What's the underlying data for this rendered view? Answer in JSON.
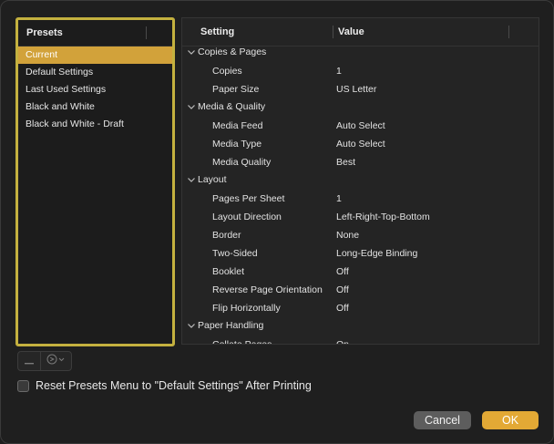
{
  "presets": {
    "header": "Presets",
    "items": [
      {
        "label": "Current",
        "selected": true
      },
      {
        "label": "Default Settings",
        "selected": false
      },
      {
        "label": "Last Used Settings",
        "selected": false
      },
      {
        "label": "Black and White",
        "selected": false
      },
      {
        "label": "Black and White - Draft",
        "selected": false
      }
    ]
  },
  "settings": {
    "header_setting": "Setting",
    "header_value": "Value",
    "rows": [
      {
        "type": "group",
        "label": "Copies & Pages",
        "value": ""
      },
      {
        "type": "item",
        "label": "Copies",
        "value": "1"
      },
      {
        "type": "item",
        "label": "Paper Size",
        "value": "US Letter"
      },
      {
        "type": "group",
        "label": "Media & Quality",
        "value": ""
      },
      {
        "type": "item",
        "label": "Media Feed",
        "value": "Auto Select"
      },
      {
        "type": "item",
        "label": "Media Type",
        "value": "Auto Select"
      },
      {
        "type": "item",
        "label": "Media Quality",
        "value": "Best"
      },
      {
        "type": "group",
        "label": "Layout",
        "value": ""
      },
      {
        "type": "item",
        "label": "Pages Per Sheet",
        "value": "1"
      },
      {
        "type": "item",
        "label": "Layout Direction",
        "value": "Left-Right-Top-Bottom"
      },
      {
        "type": "item",
        "label": "Border",
        "value": "None"
      },
      {
        "type": "item",
        "label": "Two-Sided",
        "value": "Long-Edge Binding"
      },
      {
        "type": "item",
        "label": "Booklet",
        "value": "Off"
      },
      {
        "type": "item",
        "label": "Reverse Page Orientation",
        "value": "Off"
      },
      {
        "type": "item",
        "label": "Flip Horizontally",
        "value": "Off"
      },
      {
        "type": "group",
        "label": "Paper Handling",
        "value": ""
      },
      {
        "type": "item",
        "label": "Collate Pages",
        "value": "On"
      }
    ]
  },
  "controls": {
    "remove_icon": "minus-icon",
    "action_icon": "ellipsis-circle-icon"
  },
  "reset_checkbox": {
    "label": "Reset Presets Menu to \"Default Settings\" After Printing",
    "checked": false
  },
  "buttons": {
    "cancel": "Cancel",
    "ok": "OK"
  },
  "colors": {
    "accent": "#e3a935",
    "selection": "#d2a23a",
    "focus_ring": "#c4b13f"
  }
}
